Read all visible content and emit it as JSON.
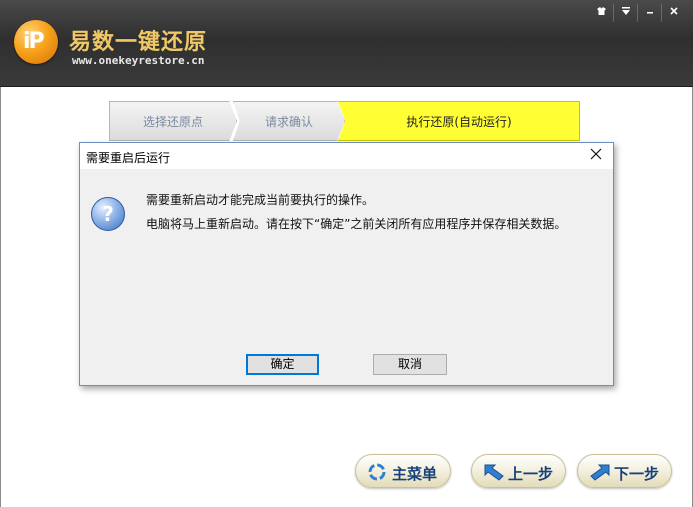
{
  "app": {
    "title": "易数一键还原",
    "url": "www.onekeyrestore.cn",
    "logo_text": "iP",
    "window_controls": [
      "skin-icon",
      "menu-icon",
      "minimize-icon",
      "close-icon"
    ]
  },
  "steps": [
    {
      "label": "选择还原点",
      "active": false
    },
    {
      "label": "请求确认",
      "active": false
    },
    {
      "label": "执行还原(自动运行)",
      "active": true
    }
  ],
  "dialog": {
    "title": "需要重启后运行",
    "icon": "question-icon",
    "message_line1": "需要重新启动才能完成当前要执行的操作。",
    "message_line2": "电脑将马上重新启动。请在按下“确定”之前关闭所有应用程序并保存相关数据。",
    "ok_label": "确定",
    "cancel_label": "取消"
  },
  "nav": {
    "menu_label": "主菜单",
    "prev_label": "上一步",
    "next_label": "下一步"
  },
  "colors": {
    "active_step": "#ffff33",
    "dialog_border": "#6f8dbd",
    "ok_focus": "#0078d7",
    "title_gold": "#f0c866"
  }
}
